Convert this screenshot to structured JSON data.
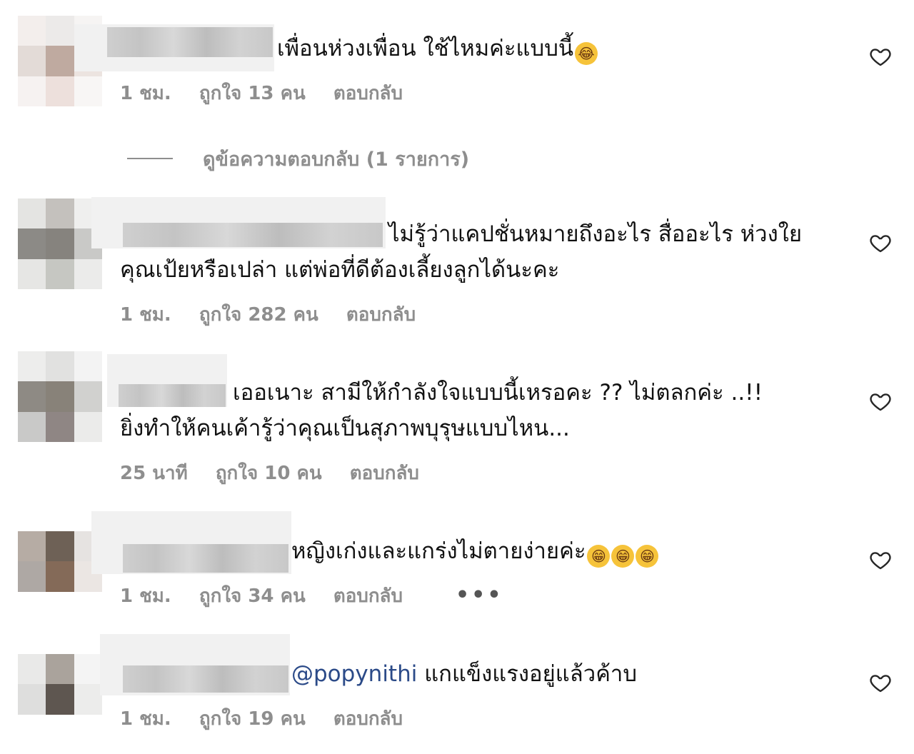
{
  "comments": [
    {
      "text_lines": [
        "เพื่อนห่วงเพื่อน ใช้ไหมค่ะแบบนี้"
      ],
      "emoji": [
        "😂"
      ],
      "time": "1 ชม.",
      "likes": "ถูกใจ 13 คน",
      "reply": "ตอบกลับ"
    },
    {
      "text_lines": [
        "ไม่รู้ว่าแคปชั่นหมายถึงอะไร สื่ออะไร ห่วงใย",
        "คุณเป้ยหรือเปล่า แต่พ่อที่ดีต้องเลี้ยงลูกได้นะคะ"
      ],
      "time": "1 ชม.",
      "likes": "ถูกใจ 282 คน",
      "reply": "ตอบกลับ"
    },
    {
      "text_lines": [
        "เออเนาะ สามีให้กำลังใจแบบนี้เหรอคะ ?? ไม่ตลกค่ะ ..!!",
        "ยิ่งทำให้คนเค้ารู้ว่าคุณเป็นสุภาพบุรุษแบบไหน..."
      ],
      "time": "25 นาที",
      "likes": "ถูกใจ 10 คน",
      "reply": "ตอบกลับ"
    },
    {
      "text_lines": [
        "หญิงเก่งและแกร่งไม่ตายง่ายค่ะ"
      ],
      "emoji": [
        "😁",
        "😁",
        "😁"
      ],
      "time": "1 ชม.",
      "likes": "ถูกใจ 34 คน",
      "reply": "ตอบกลับ",
      "more": "•••"
    },
    {
      "mention": "@popynithi",
      "text_lines": [
        " แกแข็งแรงอยู่แล้วค้าบ"
      ],
      "time": "1 ชม.",
      "likes": "ถูกใจ 19 คน",
      "reply": "ตอบกลับ"
    }
  ],
  "view_replies": "ดูข้อความตอบกลับ (1 รายการ)",
  "icons": {
    "like": "heart-outline-icon",
    "more": "more-options-icon"
  },
  "colors": {
    "meta": "#8e8e8e",
    "mention": "#2b4a88",
    "text": "#111111"
  }
}
